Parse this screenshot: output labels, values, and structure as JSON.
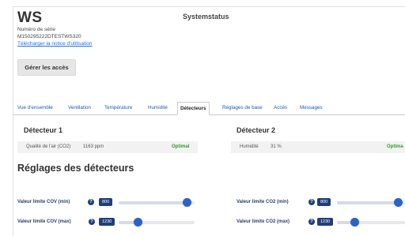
{
  "header": {
    "device_name": "WS",
    "serial_label": "Numéro de série",
    "serial_value": "M150295222DTESTWS320",
    "manual_link": "Télécharger la notice d'utilisation",
    "page_title": "Systemstatus",
    "access_button": "Gérer les accès"
  },
  "tabs": [
    {
      "label": "Vue d'ensemble",
      "active": false
    },
    {
      "label": "Ventilation",
      "active": false
    },
    {
      "label": "Température",
      "active": false
    },
    {
      "label": "Humidité",
      "active": false
    },
    {
      "label": "Détecteurs",
      "active": true
    },
    {
      "label": "Réglages de base",
      "active": false
    },
    {
      "label": "Accès",
      "active": false
    },
    {
      "label": "Messages",
      "active": false
    }
  ],
  "detectors": {
    "d1": {
      "title": "Détecteur 1",
      "label": "Qualité de l'air (CO2)",
      "value": "1163 ppm",
      "status": "Optimal"
    },
    "d2": {
      "title": "Détecteur 2",
      "label": "Humidité",
      "value": "31 %",
      "status": "Optima"
    }
  },
  "settings": {
    "title": "Réglages des détecteurs",
    "cov_min": {
      "label": "Valeur limite COV (min)",
      "value": "800",
      "position_fraction": 0.9
    },
    "cov_max": {
      "label": "Valeur limite COV (max)",
      "value": "1230",
      "position_fraction": 0.25
    },
    "co2_min": {
      "label": "Valeur limite CO2 (min)",
      "value": "800",
      "position_fraction": 0.9
    },
    "co2_max": {
      "label": "Valeur limite CO2 (max)",
      "value": "1230",
      "position_fraction": 0.25
    }
  },
  "colors": {
    "accent": "#1f3f7a",
    "knob": "#2a64c9",
    "ok": "#2e9d2e",
    "link": "#1a73e8"
  }
}
